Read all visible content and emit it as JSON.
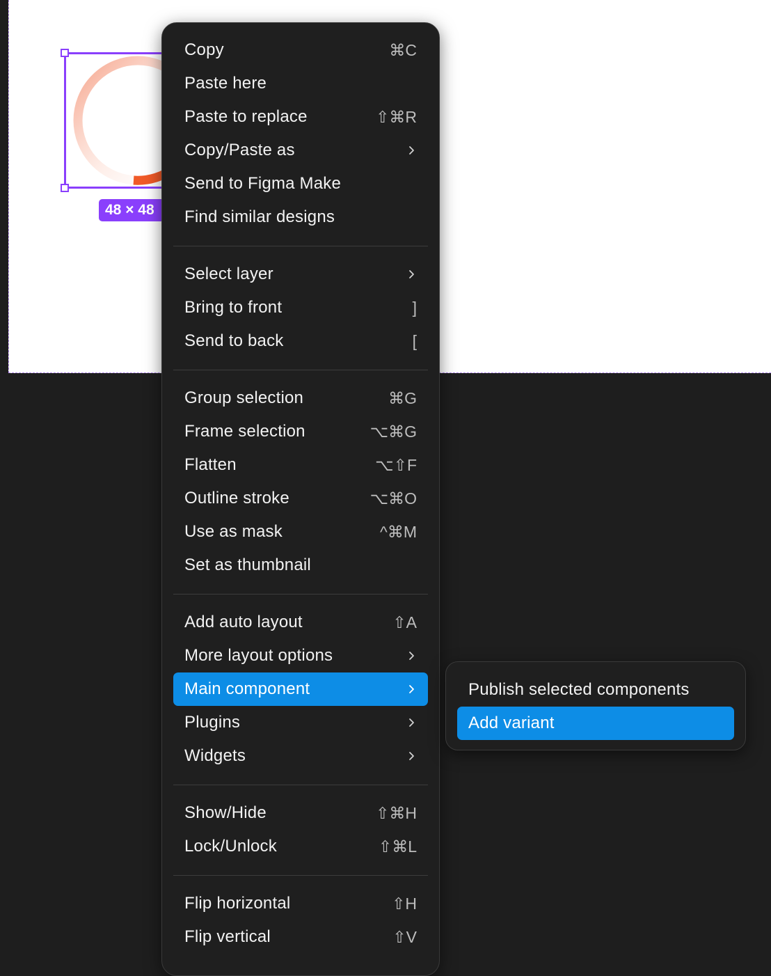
{
  "canvas": {
    "size_badge": "48 × 48",
    "selection_color": "#8a3ffc"
  },
  "menu": {
    "groups": [
      [
        {
          "label": "Copy",
          "shortcut": "⌘C"
        },
        {
          "label": "Paste here",
          "shortcut": ""
        },
        {
          "label": "Paste to replace",
          "shortcut": "⇧⌘R"
        },
        {
          "label": "Copy/Paste as",
          "submenu": true
        },
        {
          "label": "Send to Figma Make",
          "shortcut": ""
        },
        {
          "label": "Find similar designs",
          "shortcut": ""
        }
      ],
      [
        {
          "label": "Select layer",
          "submenu": true
        },
        {
          "label": "Bring to front",
          "shortcut": "]"
        },
        {
          "label": "Send to back",
          "shortcut": "["
        }
      ],
      [
        {
          "label": "Group selection",
          "shortcut": "⌘G"
        },
        {
          "label": "Frame selection",
          "shortcut": "⌥⌘G"
        },
        {
          "label": "Flatten",
          "shortcut": "⌥⇧F"
        },
        {
          "label": "Outline stroke",
          "shortcut": "⌥⌘O"
        },
        {
          "label": "Use as mask",
          "shortcut": "^⌘M"
        },
        {
          "label": "Set as thumbnail",
          "shortcut": ""
        }
      ],
      [
        {
          "label": "Add auto layout",
          "shortcut": "⇧A"
        },
        {
          "label": "More layout options",
          "submenu": true
        },
        {
          "label": "Main component",
          "submenu": true,
          "highlighted": true
        },
        {
          "label": "Plugins",
          "submenu": true
        },
        {
          "label": "Widgets",
          "submenu": true
        }
      ],
      [
        {
          "label": "Show/Hide",
          "shortcut": "⇧⌘H"
        },
        {
          "label": "Lock/Unlock",
          "shortcut": "⇧⌘L"
        }
      ],
      [
        {
          "label": "Flip horizontal",
          "shortcut": "⇧H"
        },
        {
          "label": "Flip vertical",
          "shortcut": "⇧V"
        }
      ]
    ]
  },
  "submenu": {
    "items": [
      {
        "label": "Publish selected components"
      },
      {
        "label": "Add variant",
        "highlighted": true
      }
    ]
  },
  "colors": {
    "highlight": "#0d8de6",
    "menu_bg": "#1f1f1f"
  }
}
